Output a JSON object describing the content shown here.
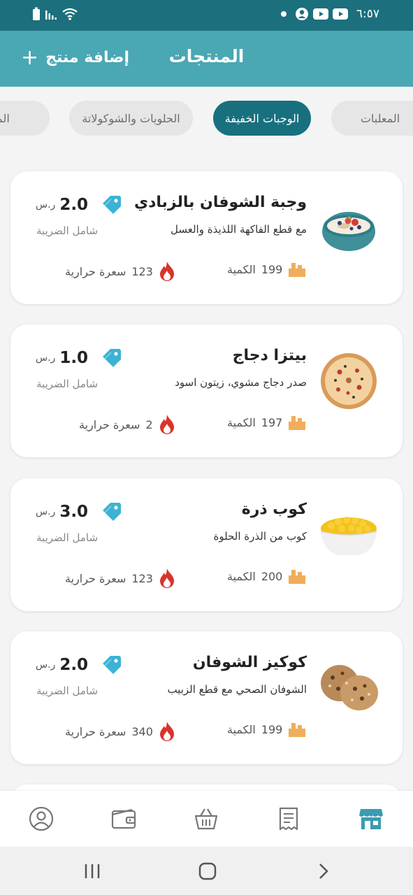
{
  "status_bar": {
    "time": "٦:٥٧",
    "icons": [
      "battery-icon",
      "signal-icon",
      "wifi-icon",
      "notification-dot-icon",
      "account-circle-icon",
      "youtube-icon",
      "youtube-icon"
    ]
  },
  "header": {
    "title": "المنتجات",
    "add_product_label": "إضافة منتج",
    "add_icon": "plus-icon",
    "bg_color": "#4aa7b4"
  },
  "categories": [
    {
      "label": "المعلبات",
      "active": false
    },
    {
      "label": "الوجبات الخفيفة",
      "active": true
    },
    {
      "label": "الحلويات والشوكولاتة",
      "active": false
    },
    {
      "label": "المشروبات",
      "active": false
    }
  ],
  "products": [
    {
      "name": "وجبة الشوفان بالزبادي",
      "description": "مع قطع الفاكهة اللذيذة والعسل",
      "price": "2.0",
      "currency": "ر.س",
      "tax_note": "شامل الضريبة",
      "quantity": "199",
      "quantity_label": "الكمية",
      "calories": "123",
      "calories_label": "سعرة حرارية",
      "image": "oat-yogurt-bowl"
    },
    {
      "name": "بيتزا دجاج",
      "description": "صدر دجاج مشوي، زيتون اسود",
      "price": "1.0",
      "currency": "ر.س",
      "tax_note": "شامل الضريبة",
      "quantity": "197",
      "quantity_label": "الكمية",
      "calories": "2",
      "calories_label": "سعرة حرارية",
      "image": "chicken-pizza"
    },
    {
      "name": "كوب ذرة",
      "description": "كوب من الذرة الحلوة",
      "price": "3.0",
      "currency": "ر.س",
      "tax_note": "شامل الضريبة",
      "quantity": "200",
      "quantity_label": "الكمية",
      "calories": "123",
      "calories_label": "سعرة حرارية",
      "image": "corn-cup"
    },
    {
      "name": "كوكيز الشوفان",
      "description": "الشوفان الصحي مع قطع الزبيب",
      "price": "2.0",
      "currency": "ر.س",
      "tax_note": "شامل الضريبة",
      "quantity": "199",
      "quantity_label": "الكمية",
      "calories": "340",
      "calories_label": "سعرة حرارية",
      "image": "oat-cookies"
    }
  ],
  "bottom_nav": [
    {
      "icon": "profile-icon",
      "active": false
    },
    {
      "icon": "wallet-icon",
      "active": false
    },
    {
      "icon": "basket-icon",
      "active": false
    },
    {
      "icon": "receipt-icon",
      "active": false
    },
    {
      "icon": "store-icon",
      "active": true
    }
  ],
  "colors": {
    "primary_dark": "#18707e",
    "primary": "#4aa7b4",
    "tag": "#3bb3d4",
    "qty_icon": "#f0ad5a",
    "fire": "#d9342b",
    "nav_inactive": "#777777"
  }
}
